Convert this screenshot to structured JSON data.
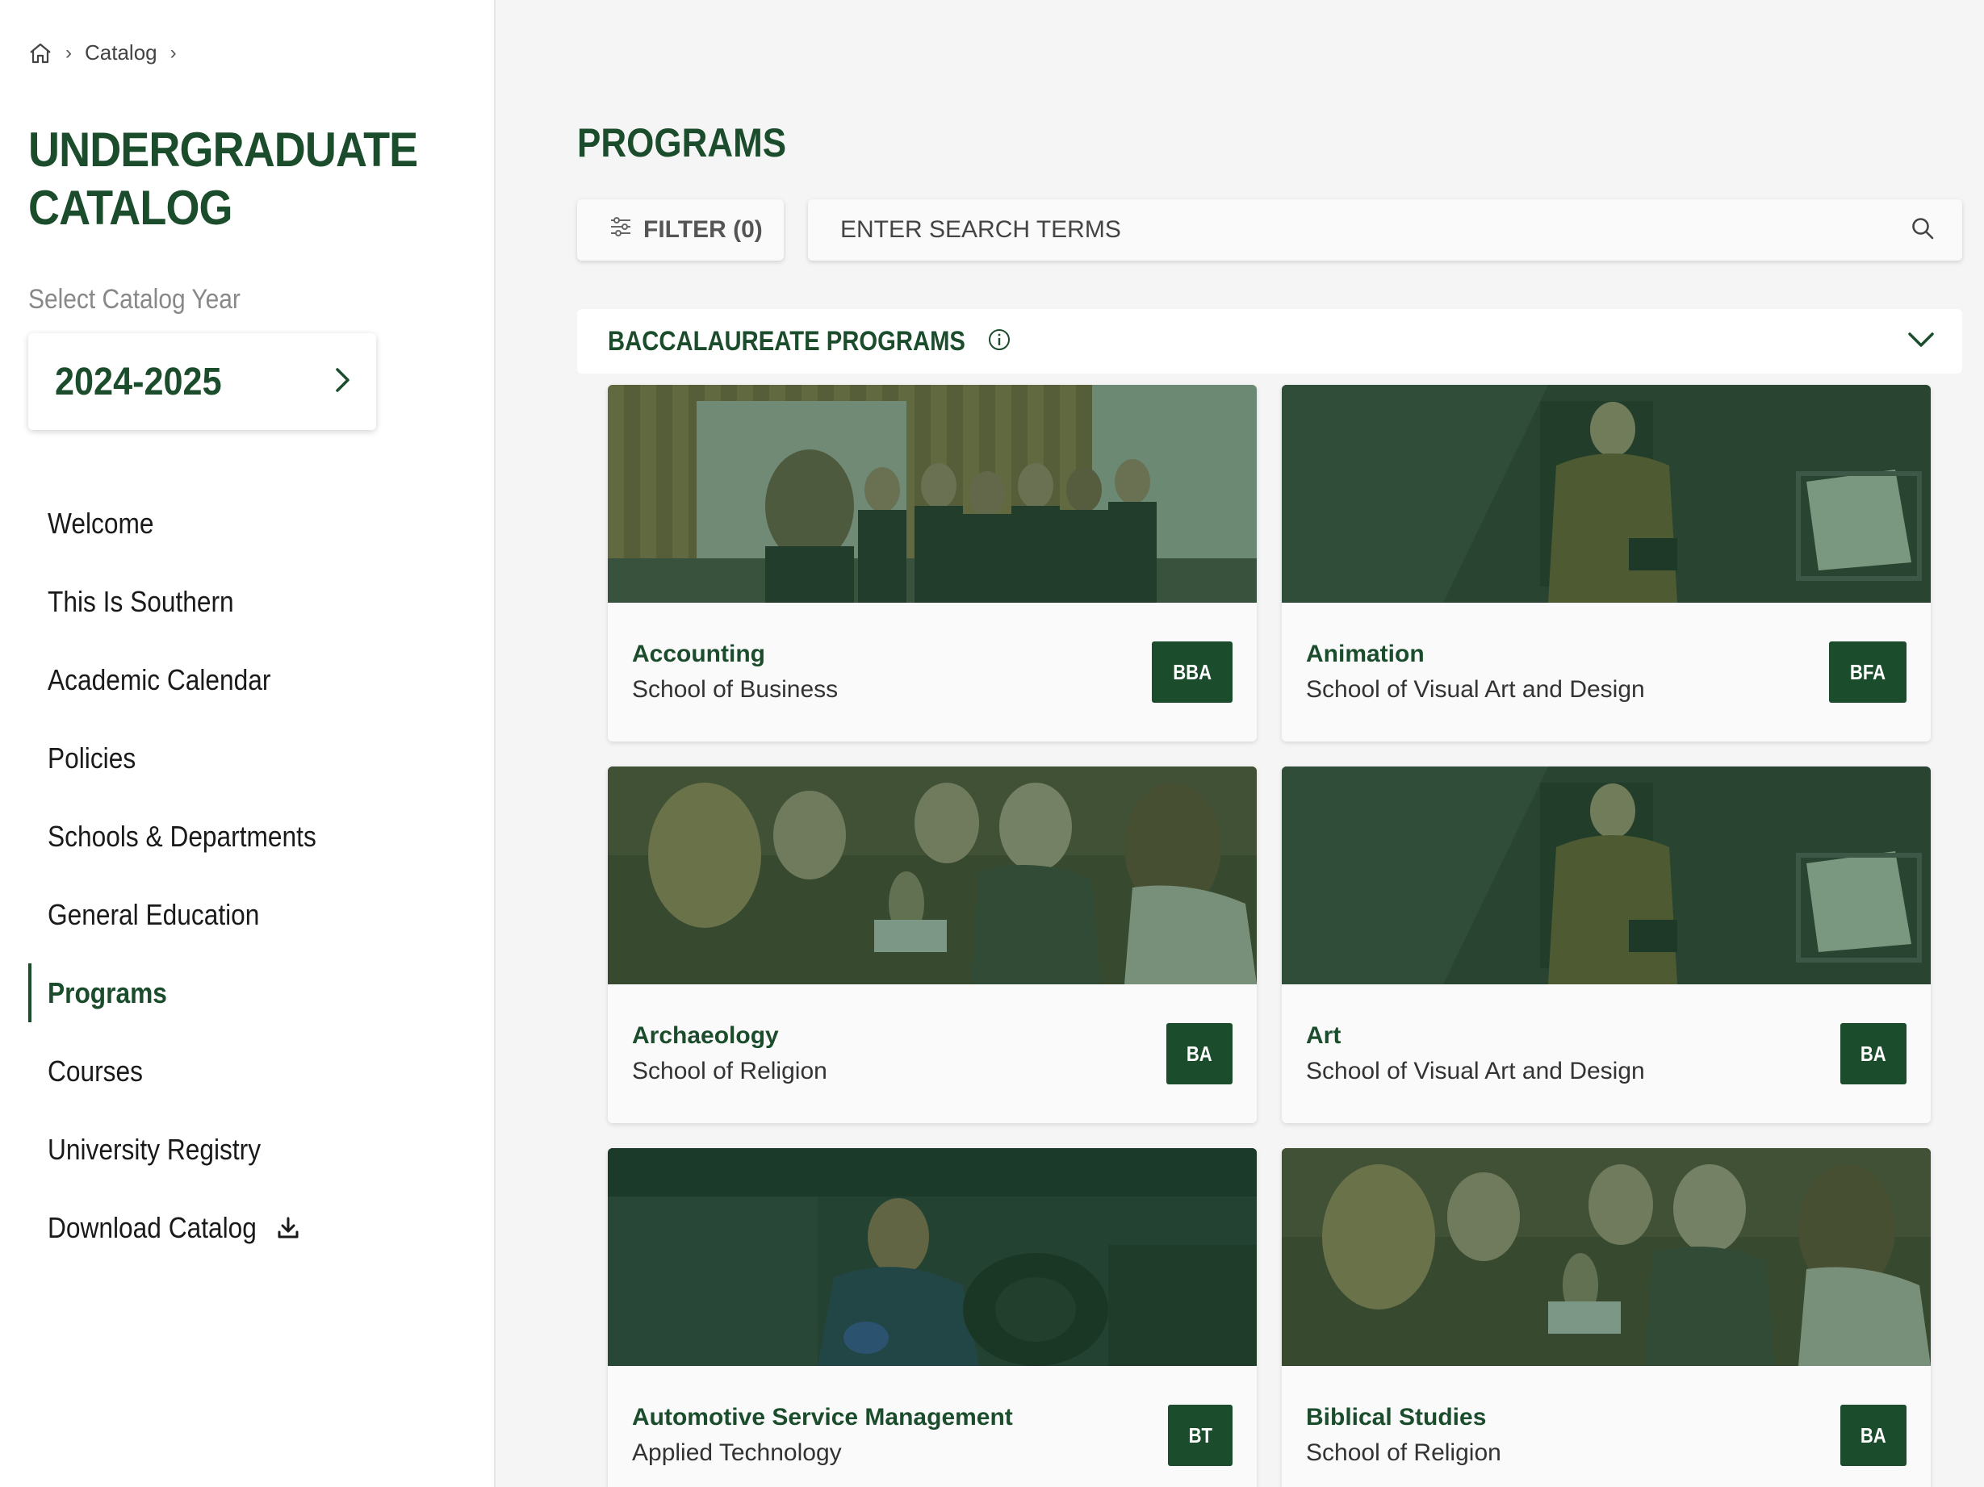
{
  "breadcrumb": {
    "catalog": "Catalog",
    "separator": "›"
  },
  "sidebar": {
    "title_line1": "UNDERGRADUATE",
    "title_line2": "CATALOG",
    "year_label": "Select Catalog Year",
    "year_value": "2024-2025",
    "nav": [
      {
        "label": "Welcome"
      },
      {
        "label": "This Is Southern"
      },
      {
        "label": "Academic Calendar"
      },
      {
        "label": "Policies"
      },
      {
        "label": "Schools & Departments"
      },
      {
        "label": "General Education"
      },
      {
        "label": "Programs",
        "active": true
      },
      {
        "label": "Courses"
      },
      {
        "label": "University Registry"
      },
      {
        "label": "Download Catalog"
      }
    ]
  },
  "main": {
    "title": "PROGRAMS",
    "filter_label": "FILTER (0)",
    "search_placeholder": "ENTER SEARCH TERMS",
    "section_title": "BACCALAUREATE PROGRAMS",
    "programs": [
      {
        "name": "Accounting",
        "school": "School of Business",
        "degree": "BBA",
        "image": "business-group"
      },
      {
        "name": "Animation",
        "school": "School of Visual Art and Design",
        "degree": "BFA",
        "image": "studio-camera"
      },
      {
        "name": "Archaeology",
        "school": "School of Religion",
        "degree": "BA",
        "image": "artifact-study"
      },
      {
        "name": "Art",
        "school": "School of Visual Art and Design",
        "degree": "BA",
        "image": "studio-camera"
      },
      {
        "name": "Automotive Service Management",
        "school": "Applied Technology",
        "degree": "BT",
        "image": "mechanic"
      },
      {
        "name": "Biblical Studies",
        "school": "School of Religion",
        "degree": "BA",
        "image": "artifact-study"
      }
    ]
  },
  "colors": {
    "brand_green": "#1b4d2c",
    "page_bg": "#f5f5f5",
    "card_bg": "#fafafa"
  },
  "icons": [
    "home-icon",
    "chevron-right-icon",
    "filter-icon",
    "search-icon",
    "info-icon",
    "chevron-down-icon",
    "download-icon"
  ]
}
